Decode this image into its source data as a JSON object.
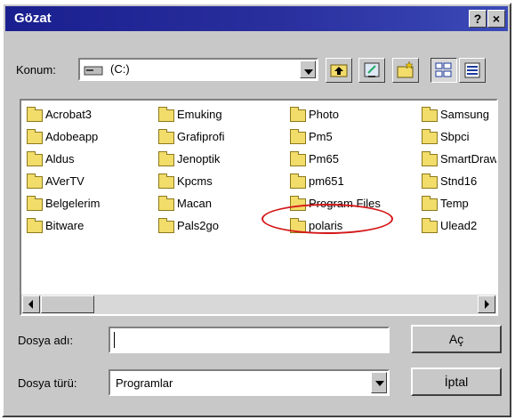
{
  "dialog": {
    "title": "Gözat",
    "help_label": "?",
    "close_label": "×"
  },
  "location": {
    "label": "Konum:",
    "value": "(C:)"
  },
  "files": [
    [
      "Acrobat3",
      "Emuking",
      "Photo",
      "Samsung"
    ],
    [
      "Adobeapp",
      "Grafiprofi",
      "Pm5",
      "Sbpci"
    ],
    [
      "Aldus",
      "Jenoptik",
      "Pm65",
      "SmartDraw"
    ],
    [
      "AVerTV",
      "Kpcms",
      "pm651",
      "Stnd16"
    ],
    [
      "Belgelerim",
      "Macan",
      "Program Files",
      "Temp"
    ],
    [
      "Bitware",
      "Pals2go",
      "polaris",
      "Ulead2"
    ]
  ],
  "filename": {
    "label": "Dosya adı:",
    "value": ""
  },
  "filetype": {
    "label": "Dosya türü:",
    "value": "Programlar"
  },
  "buttons": {
    "open": "Aç",
    "cancel": "İptal"
  },
  "colors": {
    "title_bar": "#1a1f8f",
    "highlight_circle": "#d41818",
    "folder": "#f2dc6a"
  }
}
